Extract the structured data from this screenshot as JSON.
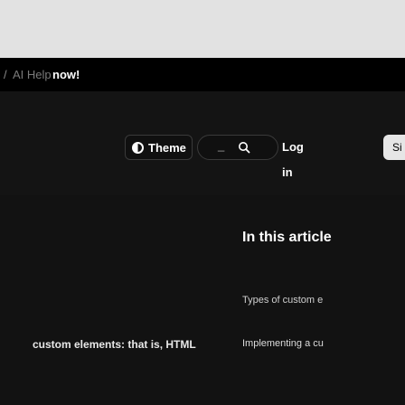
{
  "announcement": {
    "prefix": "/",
    "link_text": "AI Help",
    "suffix": "now!"
  },
  "header": {
    "theme_label": "Theme",
    "search_placeholder": "_",
    "login_label": "Log in",
    "signup_label": "Si"
  },
  "toc": {
    "title": "In this article",
    "items": [
      "Types of custom e",
      "Implementing a cu"
    ]
  },
  "article": {
    "body_fragment": "custom elements: that is, HTML"
  },
  "colors": {
    "background": "#121212",
    "top_bar": "#e2e2e2",
    "announcement_bg": "#000000",
    "text": "#ffffff"
  },
  "icons": [
    "theme-icon",
    "search-icon"
  ]
}
